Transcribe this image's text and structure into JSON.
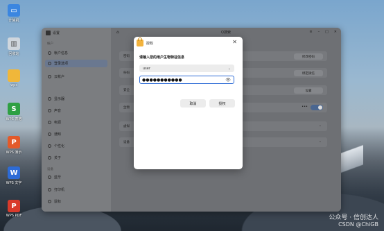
{
  "desktop": {
    "icons": [
      {
        "label": "计算机",
        "color": "#3b86e0",
        "glyph": "▭"
      },
      {
        "label": "回收站",
        "color": "#cfd6dd",
        "glyph": "🗑"
      },
      {
        "label": "wps",
        "color": "#f0b73a",
        "glyph": "▬"
      },
      {
        "label": "WPS 表格",
        "color": "#2ea043",
        "glyph": "S"
      },
      {
        "label": "WPS 演示",
        "color": "#e35a2a",
        "glyph": "P"
      },
      {
        "label": "WPS 文字",
        "color": "#2d6bd6",
        "glyph": "W"
      },
      {
        "label": "WPS PDF",
        "color": "#d93a2b",
        "glyph": "P"
      }
    ]
  },
  "settings": {
    "title": "设置",
    "search_label": "Q搜索",
    "sidebar": {
      "group_account": "帐户",
      "group_system": "设备",
      "items": [
        {
          "label": "帐户信息",
          "active": false
        },
        {
          "label": "登录选项",
          "active": true
        },
        {
          "label": "云帐户",
          "active": false
        },
        {
          "label": "显示器",
          "active": false
        },
        {
          "label": "声音",
          "active": false
        },
        {
          "label": "电源",
          "active": false
        },
        {
          "label": "通知",
          "active": false
        },
        {
          "label": "个性化",
          "active": false
        },
        {
          "label": "关于",
          "active": false
        },
        {
          "label": "蓝牙",
          "active": false
        },
        {
          "label": "打印机",
          "active": false
        },
        {
          "label": "鼠标",
          "active": false
        }
      ]
    },
    "rows": [
      {
        "label": "密码",
        "button": "修改密码"
      },
      {
        "label": "扫码",
        "button": "绑定微信"
      },
      {
        "label": "安全",
        "button": "设置"
      },
      {
        "label": "生物"
      },
      {
        "label": "虚拟"
      },
      {
        "label": "设备"
      }
    ]
  },
  "dialog": {
    "title": "授权",
    "prompt": "请输入您的用户生物特征信息",
    "user": "user",
    "password_mask": "●●●●●●●●●●●",
    "cancel_label": "取消",
    "confirm_label": "授权"
  },
  "watermark": {
    "line1": "公众号 · 信创达人",
    "line2": "CSDN @ChiGB"
  }
}
